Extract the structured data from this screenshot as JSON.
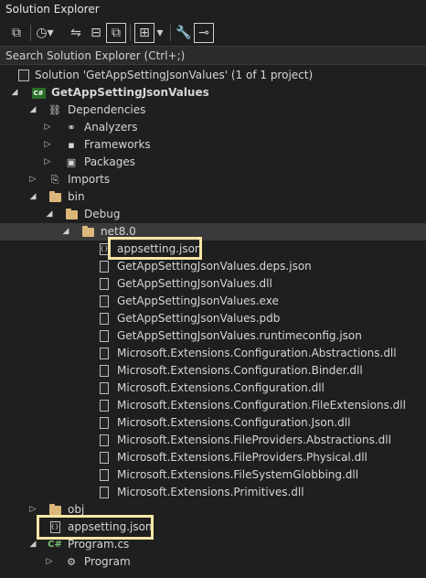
{
  "window": {
    "title": "Solution Explorer"
  },
  "search": {
    "placeholder": "Search Solution Explorer (Ctrl+;)"
  },
  "tree": {
    "solution": "Solution 'GetAppSettingJsonValues' (1 of 1 project)",
    "project": "GetAppSettingJsonValues",
    "dependencies": "Dependencies",
    "analyzers": "Analyzers",
    "frameworks": "Frameworks",
    "packages": "Packages",
    "imports": "Imports",
    "bin": "bin",
    "debug": "Debug",
    "net8": "net8.0",
    "files": [
      "appsetting.json",
      "GetAppSettingJsonValues.deps.json",
      "GetAppSettingJsonValues.dll",
      "GetAppSettingJsonValues.exe",
      "GetAppSettingJsonValues.pdb",
      "GetAppSettingJsonValues.runtimeconfig.json",
      "Microsoft.Extensions.Configuration.Abstractions.dll",
      "Microsoft.Extensions.Configuration.Binder.dll",
      "Microsoft.Extensions.Configuration.dll",
      "Microsoft.Extensions.Configuration.FileExtensions.dll",
      "Microsoft.Extensions.Configuration.Json.dll",
      "Microsoft.Extensions.FileProviders.Abstractions.dll",
      "Microsoft.Extensions.FileProviders.Physical.dll",
      "Microsoft.Extensions.FileSystemGlobbing.dll",
      "Microsoft.Extensions.Primitives.dll"
    ],
    "obj": "obj",
    "appsetting_root": "appsetting.json",
    "program_cs": "Program.cs",
    "program": "Program"
  },
  "colors": {
    "highlight": "#f6e6a6",
    "folder": "#dcb67a",
    "csproj": "#2b6e2b"
  }
}
